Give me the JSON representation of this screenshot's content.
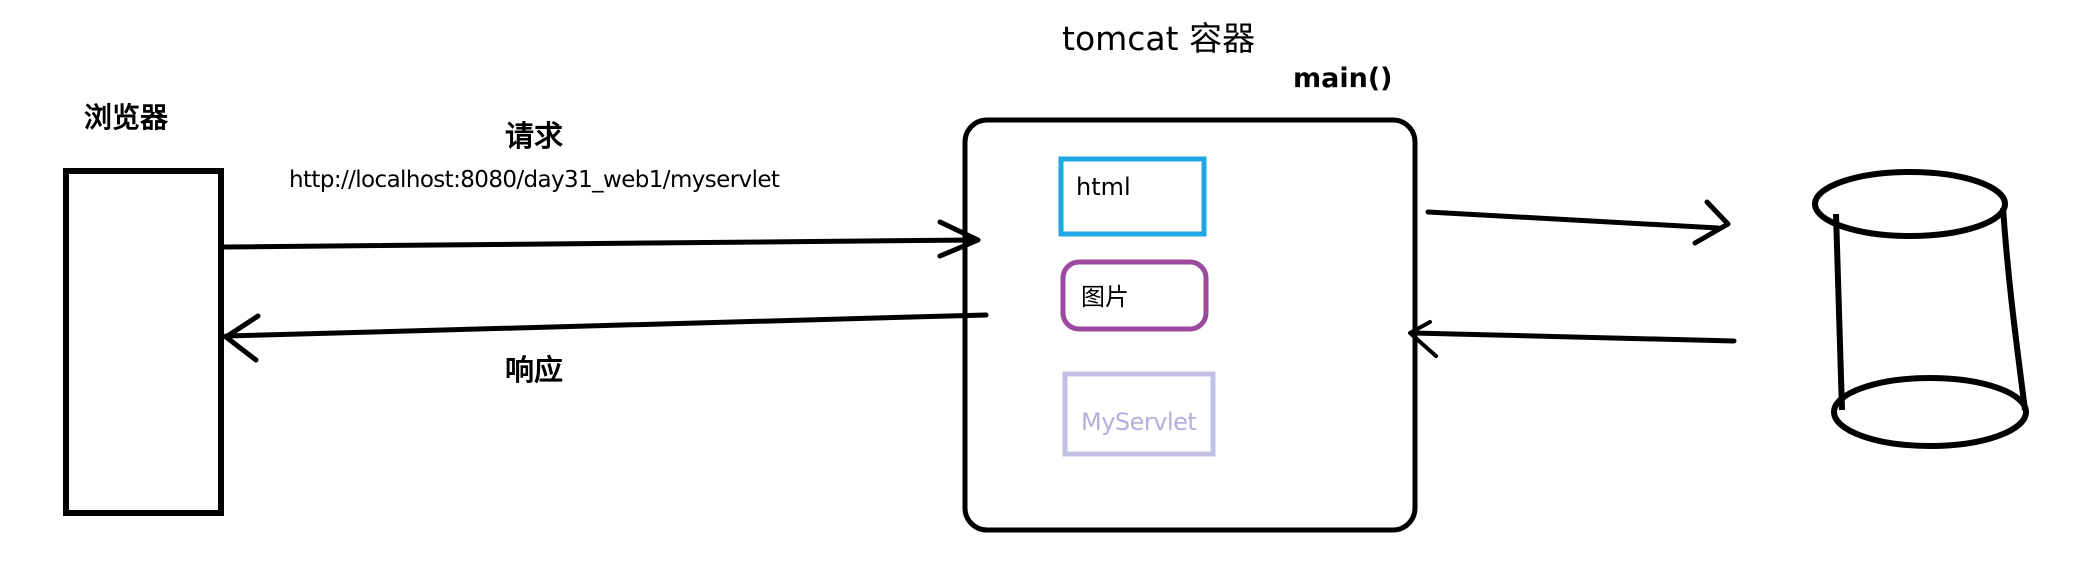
{
  "labels": {
    "browser": "浏览器",
    "request": "请求",
    "url": "http://localhost:8080/day31_web1/myservlet",
    "response": "响应",
    "container_title": "tomcat 容器",
    "main": "main()"
  },
  "container_items": [
    {
      "label": "html",
      "color": "#1ea7e1"
    },
    {
      "label": "图片",
      "color": "#9b4a9e"
    },
    {
      "label": "MyServlet",
      "color": "#c3c0e6"
    }
  ],
  "colors": {
    "stroke": "#000000",
    "myservlet_text": "#b3afde"
  }
}
